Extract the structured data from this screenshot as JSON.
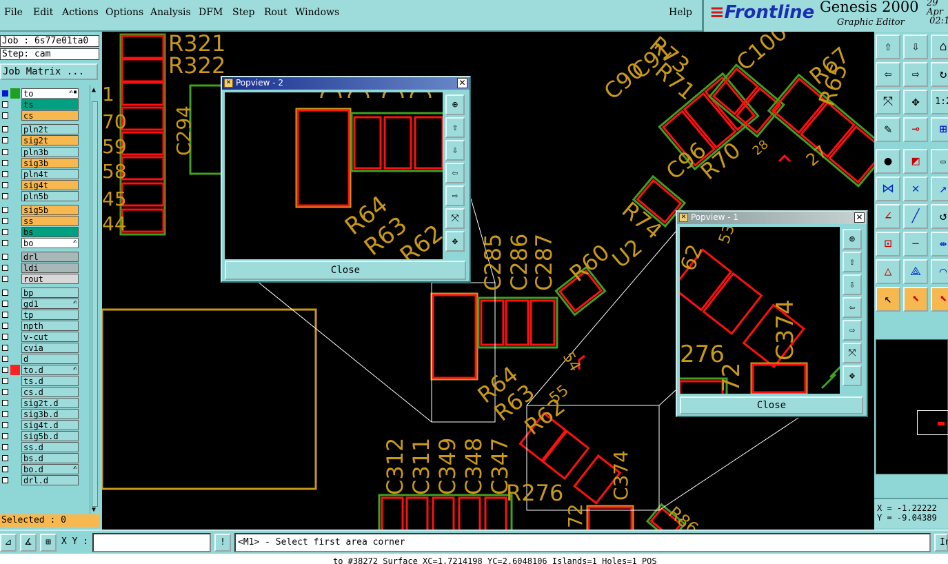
{
  "menu": {
    "items": [
      "File",
      "Edit",
      "Actions",
      "Options",
      "Analysis",
      "DFM",
      "Step",
      "Rout",
      "Windows"
    ],
    "help": "Help"
  },
  "brand": {
    "logo": "Frontline",
    "product": "Genesis 2000",
    "subtitle": "Graphic Editor",
    "date": "29 Apr",
    "time": "02:1"
  },
  "job": {
    "job_line": "Job : 6s77e01ta0",
    "step_line": "Step: cam",
    "matrix_button": "Job Matrix ..."
  },
  "layers": [
    {
      "name": "to",
      "checked": true,
      "swatch": "#20a020",
      "bg": "#ffffff",
      "hand": true,
      "badge": true
    },
    {
      "name": "ts",
      "checked": false,
      "swatch": "",
      "bg": "#00a080",
      "hand": false
    },
    {
      "name": "cs",
      "checked": false,
      "swatch": "",
      "bg": "#f8b850",
      "hand": false
    },
    {
      "name": "pln2t",
      "checked": false,
      "swatch": "",
      "bg": "#9edcdc",
      "hand": false
    },
    {
      "name": "sig2t",
      "checked": false,
      "swatch": "",
      "bg": "#f8b850",
      "hand": false
    },
    {
      "name": "pln3b",
      "checked": false,
      "swatch": "",
      "bg": "#9edcdc",
      "hand": false
    },
    {
      "name": "sig3b",
      "checked": false,
      "swatch": "",
      "bg": "#f8b850",
      "hand": false
    },
    {
      "name": "pln4t",
      "checked": false,
      "swatch": "",
      "bg": "#9edcdc",
      "hand": false
    },
    {
      "name": "sig4t",
      "checked": false,
      "swatch": "",
      "bg": "#f8b850",
      "hand": false
    },
    {
      "name": "pln5b",
      "checked": false,
      "swatch": "",
      "bg": "#9edcdc",
      "hand": false
    },
    {
      "name": "sig5b",
      "checked": false,
      "swatch": "",
      "bg": "#f8b850",
      "hand": false
    },
    {
      "name": "ss",
      "checked": false,
      "swatch": "",
      "bg": "#f8b850",
      "hand": false
    },
    {
      "name": "bs",
      "checked": false,
      "swatch": "",
      "bg": "#00a080",
      "hand": false
    },
    {
      "name": "bo",
      "checked": false,
      "swatch": "",
      "bg": "#ffffff",
      "hand": true
    },
    {
      "name": "drl",
      "checked": false,
      "swatch": "",
      "bg": "#a8b8b8",
      "hand": false
    },
    {
      "name": "ldi",
      "checked": false,
      "swatch": "",
      "bg": "#a8b8b8",
      "hand": false
    },
    {
      "name": "rout",
      "checked": false,
      "swatch": "",
      "bg": "#d8d8d8",
      "hand": false
    },
    {
      "name": "bp",
      "checked": false,
      "swatch": "",
      "bg": "#9edcdc",
      "hand": false
    },
    {
      "name": "gd1",
      "checked": false,
      "swatch": "",
      "bg": "#9edcdc",
      "hand": true
    },
    {
      "name": "tp",
      "checked": false,
      "swatch": "",
      "bg": "#9edcdc",
      "hand": false
    },
    {
      "name": "npth",
      "checked": false,
      "swatch": "",
      "bg": "#9edcdc",
      "hand": false
    },
    {
      "name": "v-cut",
      "checked": false,
      "swatch": "",
      "bg": "#9edcdc",
      "hand": false
    },
    {
      "name": "cvia",
      "checked": false,
      "swatch": "",
      "bg": "#9edcdc",
      "hand": false
    },
    {
      "name": "d",
      "checked": false,
      "swatch": "",
      "bg": "#9edcdc",
      "hand": false
    },
    {
      "name": "to.d",
      "checked": false,
      "swatch": "#ff2020",
      "bg": "#9edcdc",
      "hand": true
    },
    {
      "name": "ts.d",
      "checked": false,
      "swatch": "",
      "bg": "#9edcdc",
      "hand": false
    },
    {
      "name": "cs.d",
      "checked": false,
      "swatch": "",
      "bg": "#9edcdc",
      "hand": false
    },
    {
      "name": "sig2t.d",
      "checked": false,
      "swatch": "",
      "bg": "#9edcdc",
      "hand": false
    },
    {
      "name": "sig3b.d",
      "checked": false,
      "swatch": "",
      "bg": "#9edcdc",
      "hand": false
    },
    {
      "name": "sig4t.d",
      "checked": false,
      "swatch": "",
      "bg": "#9edcdc",
      "hand": false
    },
    {
      "name": "sig5b.d",
      "checked": false,
      "swatch": "",
      "bg": "#9edcdc",
      "hand": false
    },
    {
      "name": "ss.d",
      "checked": false,
      "swatch": "",
      "bg": "#9edcdc",
      "hand": false
    },
    {
      "name": "bs.d",
      "checked": false,
      "swatch": "",
      "bg": "#9edcdc",
      "hand": false
    },
    {
      "name": "bo.d",
      "checked": false,
      "swatch": "",
      "bg": "#9edcdc",
      "hand": true
    },
    {
      "name": "drl.d",
      "checked": false,
      "swatch": "",
      "bg": "#9edcdc",
      "hand": false
    }
  ],
  "selected_text": "Selected : 0",
  "canvas_labels": {
    "refdes": [
      "R321",
      "R322",
      "C294",
      "C285",
      "C286",
      "C287",
      "R64",
      "R63",
      "R62",
      "55",
      "C312",
      "C311",
      "C349",
      "C348",
      "C347",
      "R276",
      "C374",
      "72",
      "R60",
      "U2",
      "R74",
      "C90",
      "C91",
      "C96",
      "R70",
      "C100",
      "R67",
      "R65",
      "R73",
      "R71",
      "R86",
      "54",
      "27",
      "28",
      "1",
      "70",
      "59",
      "58",
      "45",
      "44"
    ]
  },
  "popview2": {
    "title": "Popview - 2",
    "close_label": "Close",
    "labels": [
      "R64",
      "R63",
      "R62"
    ]
  },
  "popview1": {
    "title": "Popview - 1",
    "close_label": "Close",
    "labels": [
      "62",
      "53",
      "276",
      "72",
      "C374"
    ]
  },
  "coords": {
    "x_line": "X = -1.22222",
    "y_line": "Y = -9.04389"
  },
  "bottom": {
    "xy_label": "X Y :",
    "xy_value": "",
    "bang": "!",
    "prompt": "<M1> - Select first area corner",
    "in_button": "In"
  },
  "status": "to #38272 Surface XC=1.7214198 YC=2.6048106 Islands=1 Holes=1 POS",
  "colors": {
    "copper_outline": "#ff1010",
    "mask_green": "#40a020",
    "silkscreen": "#c89818",
    "panel_bg": "#8fd6d6",
    "canvas_bg": "#000000"
  }
}
